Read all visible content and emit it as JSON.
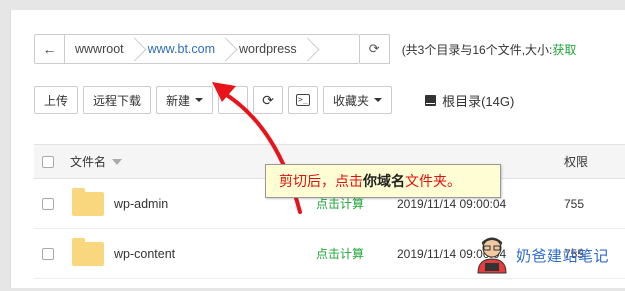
{
  "breadcrumb": {
    "back_icon": "←",
    "items": [
      "wwwroot",
      "www.bt.com",
      "wordpress"
    ],
    "refresh_icon": "⟳"
  },
  "stats": {
    "prefix": "(共3个目录与16个文件,大小:",
    "link": "获取"
  },
  "toolbar": {
    "upload": "上传",
    "remote_download": "远程下载",
    "new": "新建",
    "favorites": "收藏夹",
    "disk": "根目录(14G)"
  },
  "table": {
    "header": {
      "name": "文件名",
      "permission": "权限"
    },
    "rows": [
      {
        "name": "wp-admin",
        "size": "点击计算",
        "mtime": "2019/11/14 09:00:04",
        "perm": "755"
      },
      {
        "name": "wp-content",
        "size": "点击计算",
        "mtime": "2019/11/14 09:00:04",
        "perm": "755"
      }
    ]
  },
  "tooltip": {
    "part1": "剪切后，点击",
    "part2": "你域名",
    "part3": "文件夹。"
  },
  "watermark": {
    "text": "奶爸建站笔记"
  },
  "colors": {
    "green": "#20a53a",
    "blue": "#2d6fb7",
    "arrow_red": "#e8141b",
    "tooltip_bg": "#fffdd3"
  }
}
